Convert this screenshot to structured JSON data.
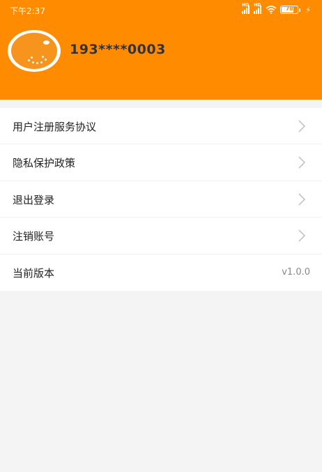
{
  "status_bar": {
    "time": "下午2:37",
    "signal1_badge": "HD",
    "signal2_badge": "HD",
    "battery_level": "78",
    "battery_level_fraction": 0.78
  },
  "profile": {
    "phone": "193****0003",
    "avatar_icon": "orange-logo-icon"
  },
  "menu": {
    "items": [
      {
        "label": "用户注册服务协议",
        "icon": "chevron-right-icon"
      },
      {
        "label": "隐私保护政策",
        "icon": "chevron-right-icon"
      },
      {
        "label": "退出登录",
        "icon": "chevron-right-icon"
      },
      {
        "label": "注销账号",
        "icon": "chevron-right-icon"
      },
      {
        "label": "当前版本",
        "value": "v1.0.0"
      }
    ]
  },
  "colors": {
    "header": "#ff8c00",
    "page_background": "#f4f4f4",
    "card": "#ffffff"
  }
}
